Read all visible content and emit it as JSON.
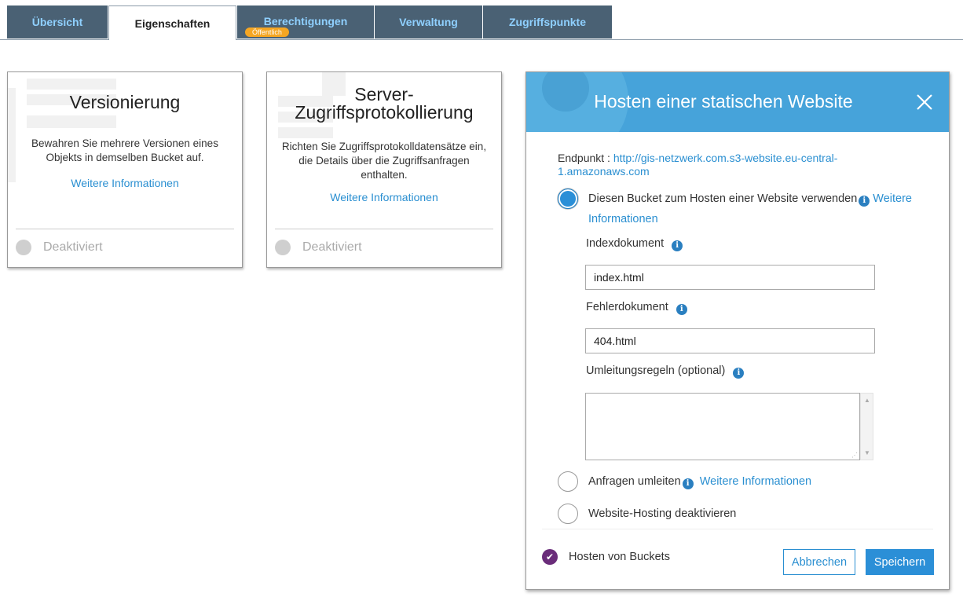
{
  "tabs": [
    {
      "label": "Übersicht"
    },
    {
      "label": "Eigenschaften"
    },
    {
      "label": "Berechtigungen",
      "badge": "Öffentlich"
    },
    {
      "label": "Verwaltung"
    },
    {
      "label": "Zugriffspunkte"
    }
  ],
  "cards": {
    "versioning": {
      "title": "Versionierung",
      "description": "Bewahren Sie mehrere Versionen eines Objekts in demselben Bucket auf.",
      "link": "Weitere Informationen",
      "status": "Deaktiviert"
    },
    "logging": {
      "title": "Server-Zugriffsprotokollierung",
      "description": "Richten Sie Zugriffsprotokolldatensätze ein, die Details über die Zugriffsanfragen enthalten.",
      "link": "Weitere Informationen",
      "status": "Deaktiviert"
    }
  },
  "modal": {
    "title": "Hosten einer statischen Website",
    "endpoint_label": "Endpunkt : ",
    "endpoint_url": "http://gis-netzwerk.com.s3-website.eu-central-1.amazonaws.com",
    "options": {
      "use_bucket": "Diesen Bucket zum Hosten einer Website verwenden",
      "use_bucket_link": "Weitere Informationen",
      "redirect": "Anfragen umleiten",
      "redirect_link": "Weitere Informationen",
      "disable": "Website-Hosting deaktivieren"
    },
    "fields": {
      "index_label": "Indexdokument",
      "index_value": "index.html",
      "error_label": "Fehlerdokument",
      "error_value": "404.html",
      "redirect_rules_label": "Umleitungsregeln (optional)",
      "redirect_rules_value": ""
    },
    "footer": {
      "hosting_status": "Hosten von Buckets",
      "cancel": "Abbrechen",
      "save": "Speichern"
    }
  },
  "colors": {
    "tab_bg": "#4a6174",
    "tab_text": "#8fd0ff",
    "badge": "#f5a623",
    "header_blue": "#46a3da",
    "link_blue": "#2a8fd1",
    "check_purple": "#6a2c7a"
  },
  "icons": {
    "close": "close-icon",
    "info": "info-icon",
    "check": "checkmark-icon"
  }
}
